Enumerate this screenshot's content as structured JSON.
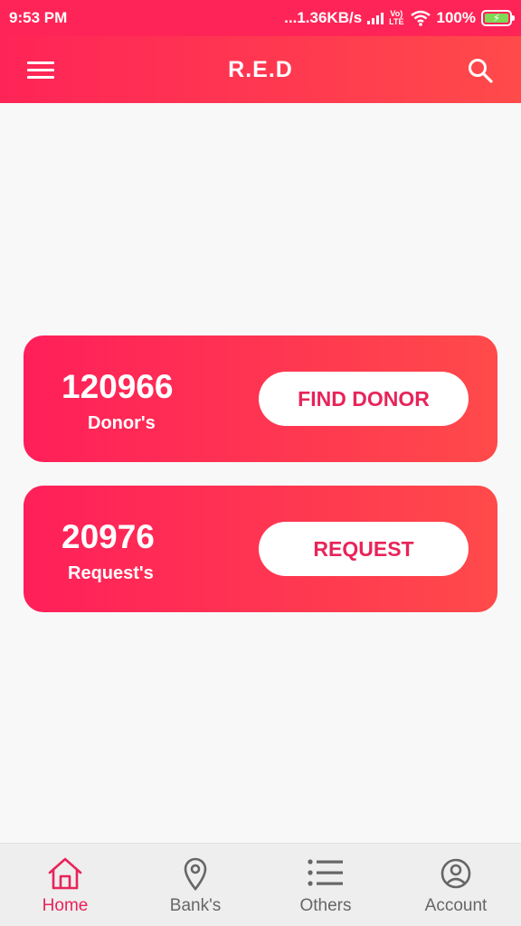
{
  "status_bar": {
    "time": "9:53 PM",
    "network_speed": "...1.36KB/s",
    "volte": "Vo) LTE",
    "battery": "100%"
  },
  "app_bar": {
    "title": "R.E.D"
  },
  "cards": {
    "donor": {
      "count": "120966",
      "label": "Donor's",
      "button": "FIND DONOR"
    },
    "request": {
      "count": "20976",
      "label": "Request's",
      "button": "REQUEST"
    }
  },
  "bottom_nav": {
    "items": [
      {
        "label": "Home",
        "icon": "home-icon",
        "active": true
      },
      {
        "label": "Bank's",
        "icon": "location-pin-icon",
        "active": false
      },
      {
        "label": "Others",
        "icon": "list-icon",
        "active": false
      },
      {
        "label": "Account",
        "icon": "account-circle-icon",
        "active": false
      }
    ]
  },
  "colors": {
    "primary": "#ff2457",
    "accent": "#e8245a",
    "battery": "#7ed957"
  }
}
